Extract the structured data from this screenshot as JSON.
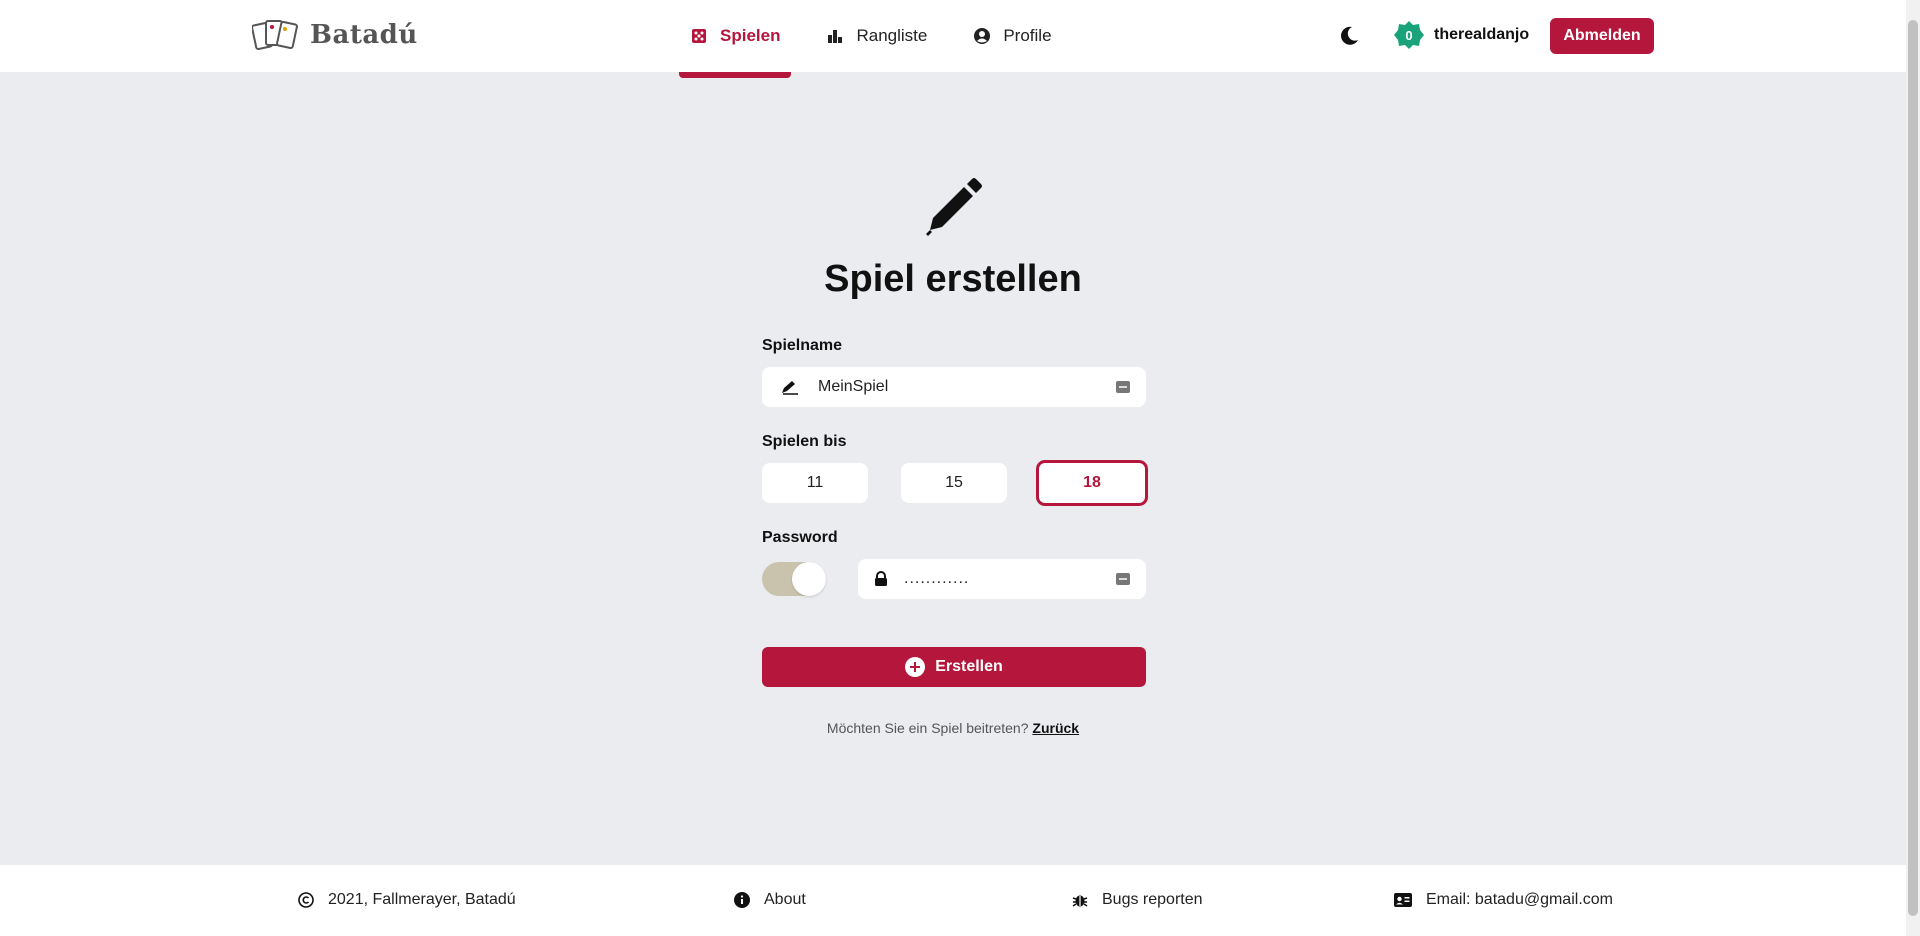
{
  "header": {
    "brand": "Batadú",
    "nav": [
      {
        "label": "Spielen",
        "icon": "dice-icon",
        "active": true
      },
      {
        "label": "Rangliste",
        "icon": "bar-chart-icon",
        "active": false
      },
      {
        "label": "Profile",
        "icon": "user-circle-icon",
        "active": false
      }
    ],
    "user": {
      "badge": "0",
      "name": "therealdanjo"
    },
    "logout_label": "Abmelden"
  },
  "main": {
    "title": "Spiel erstellen",
    "game_name": {
      "label": "Spielname",
      "value": "MeinSpiel"
    },
    "play_until": {
      "label": "Spielen bis",
      "options": [
        "11",
        "15",
        "18"
      ],
      "selected": "18"
    },
    "password": {
      "label": "Password",
      "enabled": true,
      "value": "............"
    },
    "create_label": "Erstellen",
    "join_hint": "Möchten Sie ein Spiel beitreten?",
    "back_link": "Zurück"
  },
  "footer": {
    "copyright": "2021, Fallmerayer, Batadú",
    "about": "About",
    "bugs": "Bugs reporten",
    "email": "Email: batadu@gmail.com"
  },
  "colors": {
    "accent": "#b5163b",
    "badge": "#1aa37a",
    "background": "#ebecf0"
  }
}
